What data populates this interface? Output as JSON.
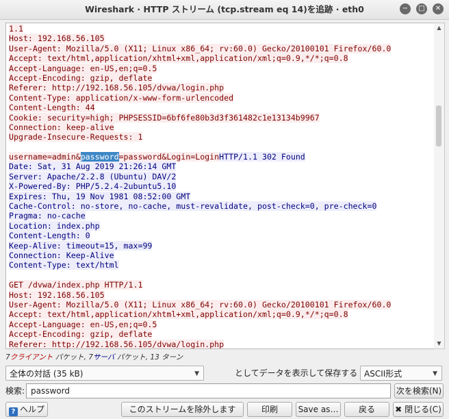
{
  "window": {
    "title": "Wireshark · HTTP ストリーム (tcp.stream eq 14)を追跡 · eth0",
    "min_symbol": "−",
    "max_symbol": "□",
    "close_symbol": "✕"
  },
  "stream": {
    "lines": [
      {
        "type": "client",
        "text": "1.1"
      },
      {
        "type": "client",
        "text": "Host: 192.168.56.105"
      },
      {
        "type": "client",
        "text": "User-Agent: Mozilla/5.0 (X11; Linux x86_64; rv:60.0) Gecko/20100101 Firefox/60.0"
      },
      {
        "type": "client",
        "text": "Accept: text/html,application/xhtml+xml,application/xml;q=0.9,*/*;q=0.8"
      },
      {
        "type": "client",
        "text": "Accept-Language: en-US,en;q=0.5"
      },
      {
        "type": "client",
        "text": "Accept-Encoding: gzip, deflate"
      },
      {
        "type": "client",
        "text": "Referer: http://192.168.56.105/dvwa/login.php"
      },
      {
        "type": "client",
        "text": "Content-Type: application/x-www-form-urlencoded"
      },
      {
        "type": "client",
        "text": "Content-Length: 44"
      },
      {
        "type": "client",
        "text": "Cookie: security=high; PHPSESSID=6bf6fe80b3d3f361482c1e13134b9967"
      },
      {
        "type": "client",
        "text": "Connection: keep-alive"
      },
      {
        "type": "client",
        "text": "Upgrade-Insecure-Requests: 1"
      },
      {
        "type": "blank",
        "text": ""
      },
      {
        "type": "mixed",
        "parts": [
          {
            "cls": "client",
            "text": "username=admin&"
          },
          {
            "cls": "hl",
            "text": "password"
          },
          {
            "cls": "client",
            "text": "=password&Login=Login"
          },
          {
            "cls": "server",
            "text": "HTTP/1.1 302 Found"
          }
        ]
      },
      {
        "type": "server",
        "text": "Date: Sat, 31 Aug 2019 21:26:14 GMT"
      },
      {
        "type": "server",
        "text": "Server: Apache/2.2.8 (Ubuntu) DAV/2"
      },
      {
        "type": "server",
        "text": "X-Powered-By: PHP/5.2.4-2ubuntu5.10"
      },
      {
        "type": "server",
        "text": "Expires: Thu, 19 Nov 1981 08:52:00 GMT"
      },
      {
        "type": "server",
        "text": "Cache-Control: no-store, no-cache, must-revalidate, post-check=0, pre-check=0"
      },
      {
        "type": "server",
        "text": "Pragma: no-cache"
      },
      {
        "type": "server",
        "text": "Location: index.php"
      },
      {
        "type": "server",
        "text": "Content-Length: 0"
      },
      {
        "type": "server",
        "text": "Keep-Alive: timeout=15, max=99"
      },
      {
        "type": "server",
        "text": "Connection: Keep-Alive"
      },
      {
        "type": "server",
        "text": "Content-Type: text/html"
      },
      {
        "type": "blank",
        "text": ""
      },
      {
        "type": "client",
        "text": "GET /dvwa/index.php HTTP/1.1"
      },
      {
        "type": "client",
        "text": "Host: 192.168.56.105"
      },
      {
        "type": "client",
        "text": "User-Agent: Mozilla/5.0 (X11; Linux x86_64; rv:60.0) Gecko/20100101 Firefox/60.0"
      },
      {
        "type": "client",
        "text": "Accept: text/html,application/xhtml+xml,application/xml;q=0.9,*/*;q=0.8"
      },
      {
        "type": "client",
        "text": "Accept-Language: en-US,en;q=0.5"
      },
      {
        "type": "client",
        "text": "Accept-Encoding: gzip, deflate"
      },
      {
        "type": "client",
        "text": "Referer: http://192.168.56.105/dvwa/login.php"
      }
    ]
  },
  "stats": {
    "client_pkts": "7",
    "client_label": "クライアント",
    "pkts_word": " パケット, ",
    "server_pkts": "7",
    "server_label": "サーバ",
    "turns": " パケット, 13 ターン"
  },
  "conversation": {
    "selected": "全体の対話 (35 kB)"
  },
  "save_as": {
    "label": "としてデータを表示して保存する",
    "format": "ASCII形式"
  },
  "search": {
    "label": "検索:",
    "value": "password",
    "next_button": "次を検索(N)"
  },
  "buttons": {
    "help": "ヘルプ",
    "filter_out": "このストリームを除外します",
    "print": "印刷",
    "save_as": "Save as…",
    "back": "戻る",
    "close": "閉じる(C)"
  },
  "colors": {
    "client_bg": "#fbeded",
    "client_fg": "#7f0000",
    "server_bg": "#ededfb",
    "server_fg": "#00007f",
    "highlight": "#3d87c6"
  }
}
